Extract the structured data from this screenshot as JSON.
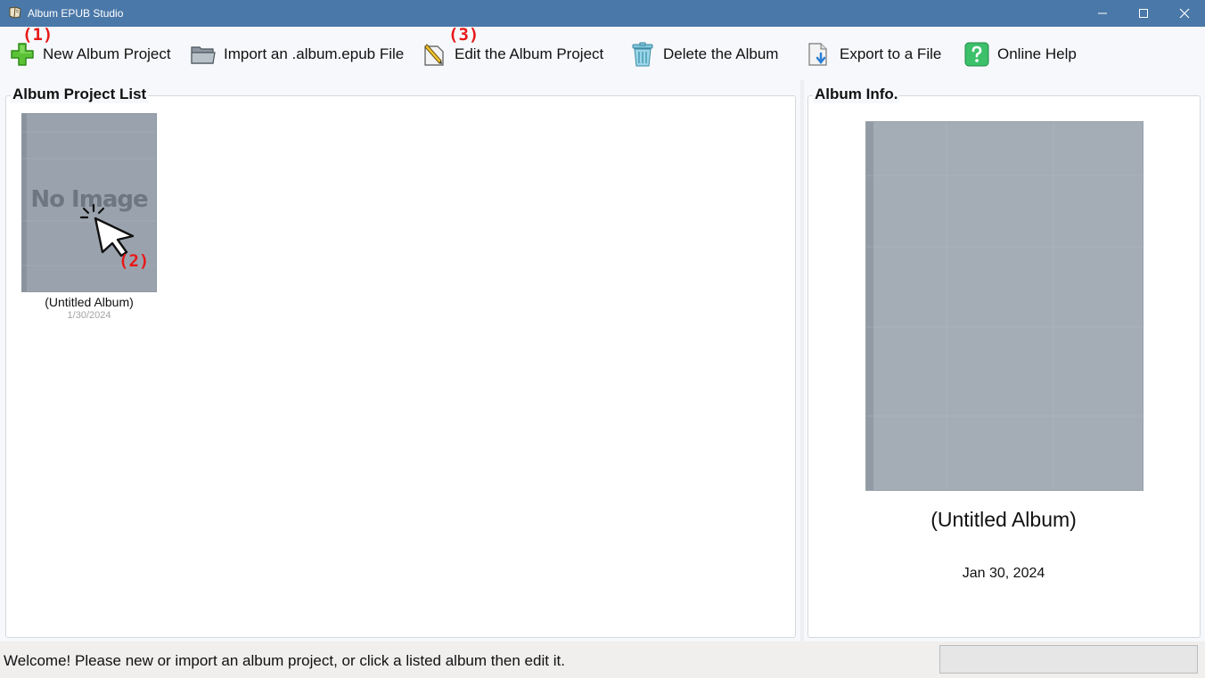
{
  "window": {
    "title": "Album EPUB Studio",
    "icon": "book-icon",
    "controls": [
      "minimize-icon",
      "maximize-icon",
      "close-icon"
    ],
    "accent": "#4a78a8"
  },
  "toolbar": {
    "items": [
      {
        "label": "New Album Project",
        "icon": "plus-icon"
      },
      {
        "label": "Import an .album.epub File",
        "icon": "folder-icon"
      },
      {
        "label": "Edit the Album Project",
        "icon": "edit-icon"
      },
      {
        "label": "Delete the Album",
        "icon": "trash-icon"
      },
      {
        "label": "Export to a File",
        "icon": "export-icon"
      },
      {
        "label": "Online Help",
        "icon": "help-icon"
      }
    ],
    "marker_colors": "#e81818"
  },
  "annotations": {
    "marker_1": "(1)",
    "marker_2": "(2)",
    "marker_3": "(3)"
  },
  "project_list": {
    "title": "Album Project List",
    "albums": [
      {
        "name": "(Untitled Album)",
        "date": "1/30/2024",
        "cover_text": "No Image"
      }
    ]
  },
  "album_info": {
    "title": "Album Info.",
    "name": "(Untitled Album)",
    "date": "Jan 30, 2024"
  },
  "status": {
    "message": "Welcome! Please new or import an album project, or click a listed album then edit it."
  }
}
